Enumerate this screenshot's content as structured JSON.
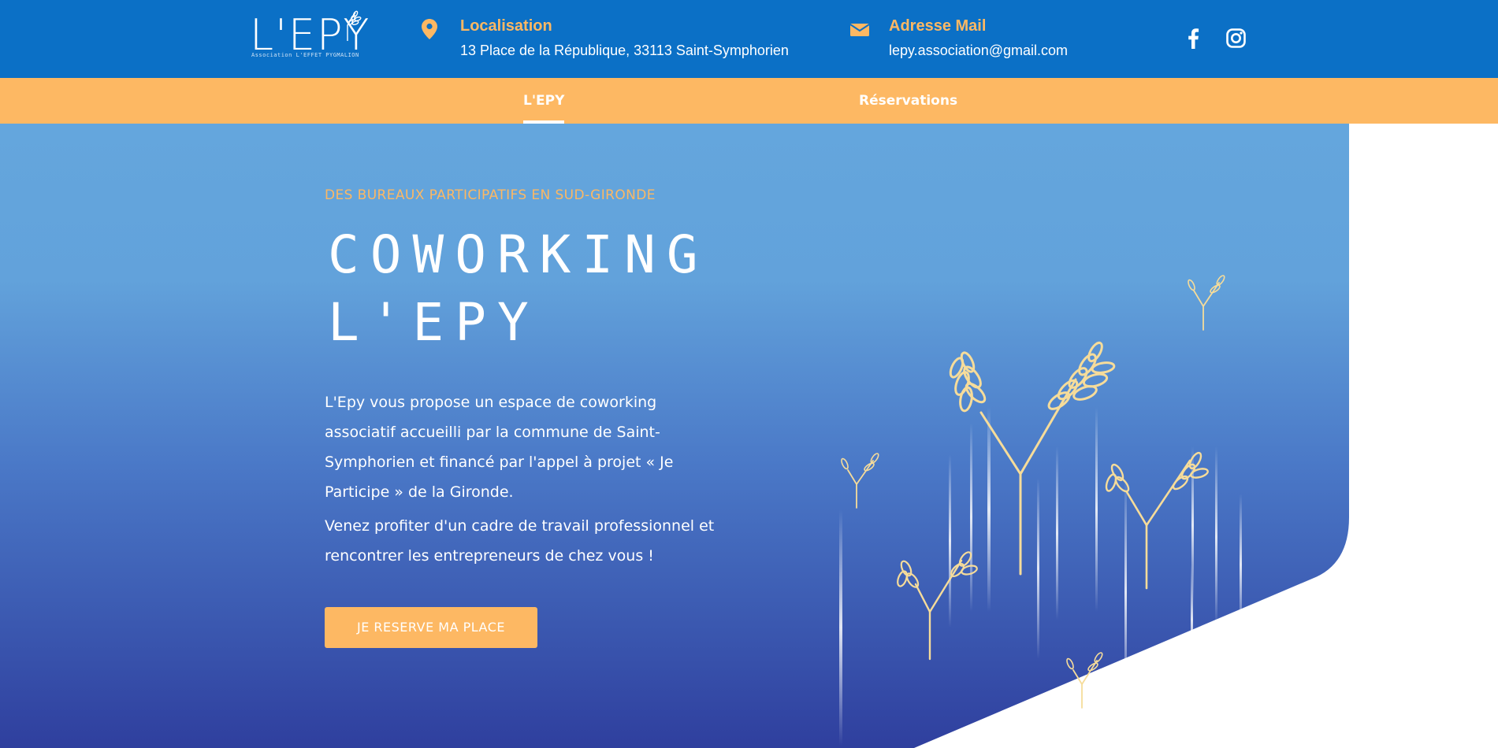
{
  "header": {
    "logo": {
      "title": "L'EPY",
      "subtitle": "Association L'EFFET PYGMALION"
    },
    "location": {
      "title": "Localisation",
      "value": "13 Place de la République, 33113 Saint-Symphorien",
      "icon": "map-pin-icon"
    },
    "email": {
      "title": "Adresse Mail",
      "value": "lepy.association@gmail.com",
      "icon": "envelope-icon"
    },
    "social": [
      {
        "name": "facebook",
        "icon": "facebook-icon"
      },
      {
        "name": "instagram",
        "icon": "instagram-icon"
      }
    ]
  },
  "nav": {
    "items": [
      {
        "label": "L'EPY",
        "active": true
      },
      {
        "label": "Réservations",
        "active": false
      }
    ]
  },
  "hero": {
    "eyebrow": "DES BUREAUX PARTICIPATIFS EN SUD-GIRONDE",
    "title_line1": "COWORKING",
    "title_line2": "L'EPY",
    "paragraph1": "L'Epy vous propose un espace de coworking associatif accueilli par la commune de Saint-Symphorien et financé par l'appel à projet « Je Participe » de la Gironde.",
    "paragraph2": "Venez profiter d'un cadre de travail professionnel et rencontrer les entrepreneurs de chez vous !",
    "cta_label": "JE RESERVE MA PLACE"
  },
  "colors": {
    "header_blue": "#0b70c6",
    "accent_orange": "#fdb863",
    "hero_top": "#64a6dd",
    "hero_bottom": "#2f3f9e",
    "wheat": "#f6dc9a"
  }
}
